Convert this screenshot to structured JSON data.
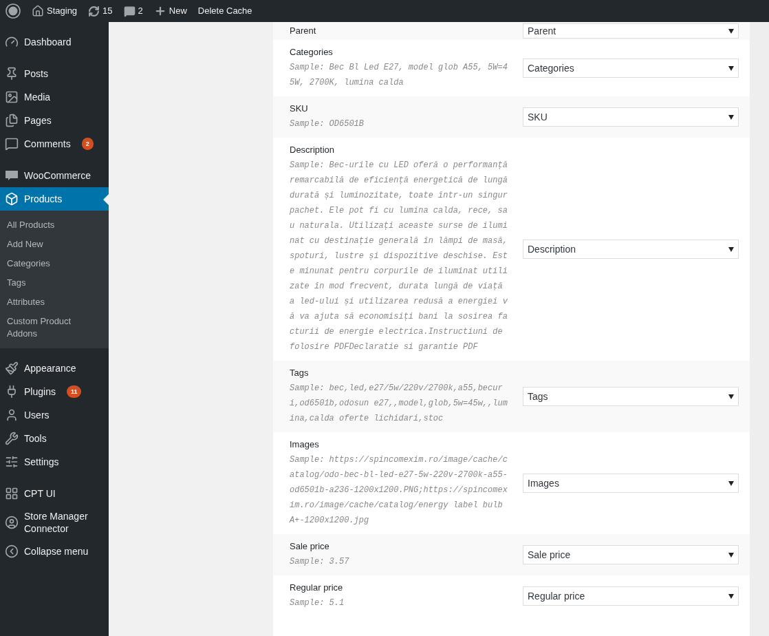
{
  "admin_bar": {
    "site": "Staging",
    "updates": "15",
    "comments": "2",
    "new": "New",
    "delete_cache": "Delete Cache"
  },
  "sidebar": {
    "groups": [
      {
        "items": [
          {
            "label": "Dashboard",
            "selected": false
          }
        ]
      },
      {
        "items": [
          {
            "label": "Posts",
            "selected": false
          },
          {
            "label": "Media",
            "selected": false
          },
          {
            "label": "Pages",
            "selected": false
          },
          {
            "label": "Comments",
            "selected": false,
            "badge": "2"
          }
        ]
      },
      {
        "items": [
          {
            "label": "WooCommerce",
            "selected": false
          },
          {
            "label": "Products",
            "selected": true,
            "children": [
              {
                "label": "All Products",
                "selected": false
              },
              {
                "label": "Add New",
                "selected": false
              },
              {
                "label": "Categories",
                "selected": false
              },
              {
                "label": "Tags",
                "selected": false
              },
              {
                "label": "Attributes",
                "selected": false
              },
              {
                "label": "Custom Product Addons",
                "selected": false
              }
            ]
          }
        ]
      },
      {
        "items": [
          {
            "label": "Appearance",
            "selected": false
          },
          {
            "label": "Plugins",
            "selected": false,
            "badge": "11"
          },
          {
            "label": "Users",
            "selected": false
          },
          {
            "label": "Tools",
            "selected": false
          },
          {
            "label": "Settings",
            "selected": false
          }
        ]
      },
      {
        "items": [
          {
            "label": "CPT UI",
            "selected": false
          },
          {
            "label": "Store Manager Connector",
            "selected": false
          },
          {
            "label": "Collapse menu",
            "selected": false
          }
        ]
      }
    ]
  },
  "fields": [
    {
      "label": "Parent",
      "select": "Parent"
    },
    {
      "label": "Categories",
      "sample": "Sample: Bec Bl Led E27, model glob A55, 5W=45W, 2700K, lumina calda",
      "select": "Categories"
    },
    {
      "label": "SKU",
      "sample": "Sample: OD6501B",
      "select": "SKU"
    },
    {
      "label": "Description",
      "sample": "Sample: Bec-urile cu LED oferă o performanță remarcabilă de eficiență energetică de lungă durată și luminozitate, toate într-un singur pachet. Ele pot fi cu lumina calda, rece, sau naturala. Utilizați aceaste surse de iluminat cu destinație generală în lămpi de masă, spoturi, lustre și dispozitive deschise. Este minunat pentru corpurile de iluminat utilizate în mod frecvent, durata lungă de viață a led-ului și utilizarea redusă a energiei vă va ajuta să economisiți bani la sosirea facturii de energie electrica.Instructiuni de folosire PDFDeclaratie si garantie PDF",
      "select": "Description"
    },
    {
      "label": "Tags",
      "sample": "Sample: bec,led,e27/5w/220v/2700k,a55,becuri,od6501b,odosun e27,,model,glob,5w=45w,,lumina,calda oferte lichidari,stoc",
      "select": "Tags"
    },
    {
      "label": "Images",
      "sample": "Sample: https://spincomexim.ro/image/cache/catalog/odo-bec-bl-led-e27-5w-220v-2700k-a55-od6501b-a236-1200x1200.PNG;https://spincomexim.ro/image/cache/catalog/energy label bulb A+-1200x1200.jpg",
      "select": "Images"
    },
    {
      "label": "Sale price",
      "sample": "Sample: 3.57",
      "select": "Sale price"
    },
    {
      "label": "Regular price",
      "sample": "Sample: 5.1",
      "select": "Regular price"
    }
  ]
}
